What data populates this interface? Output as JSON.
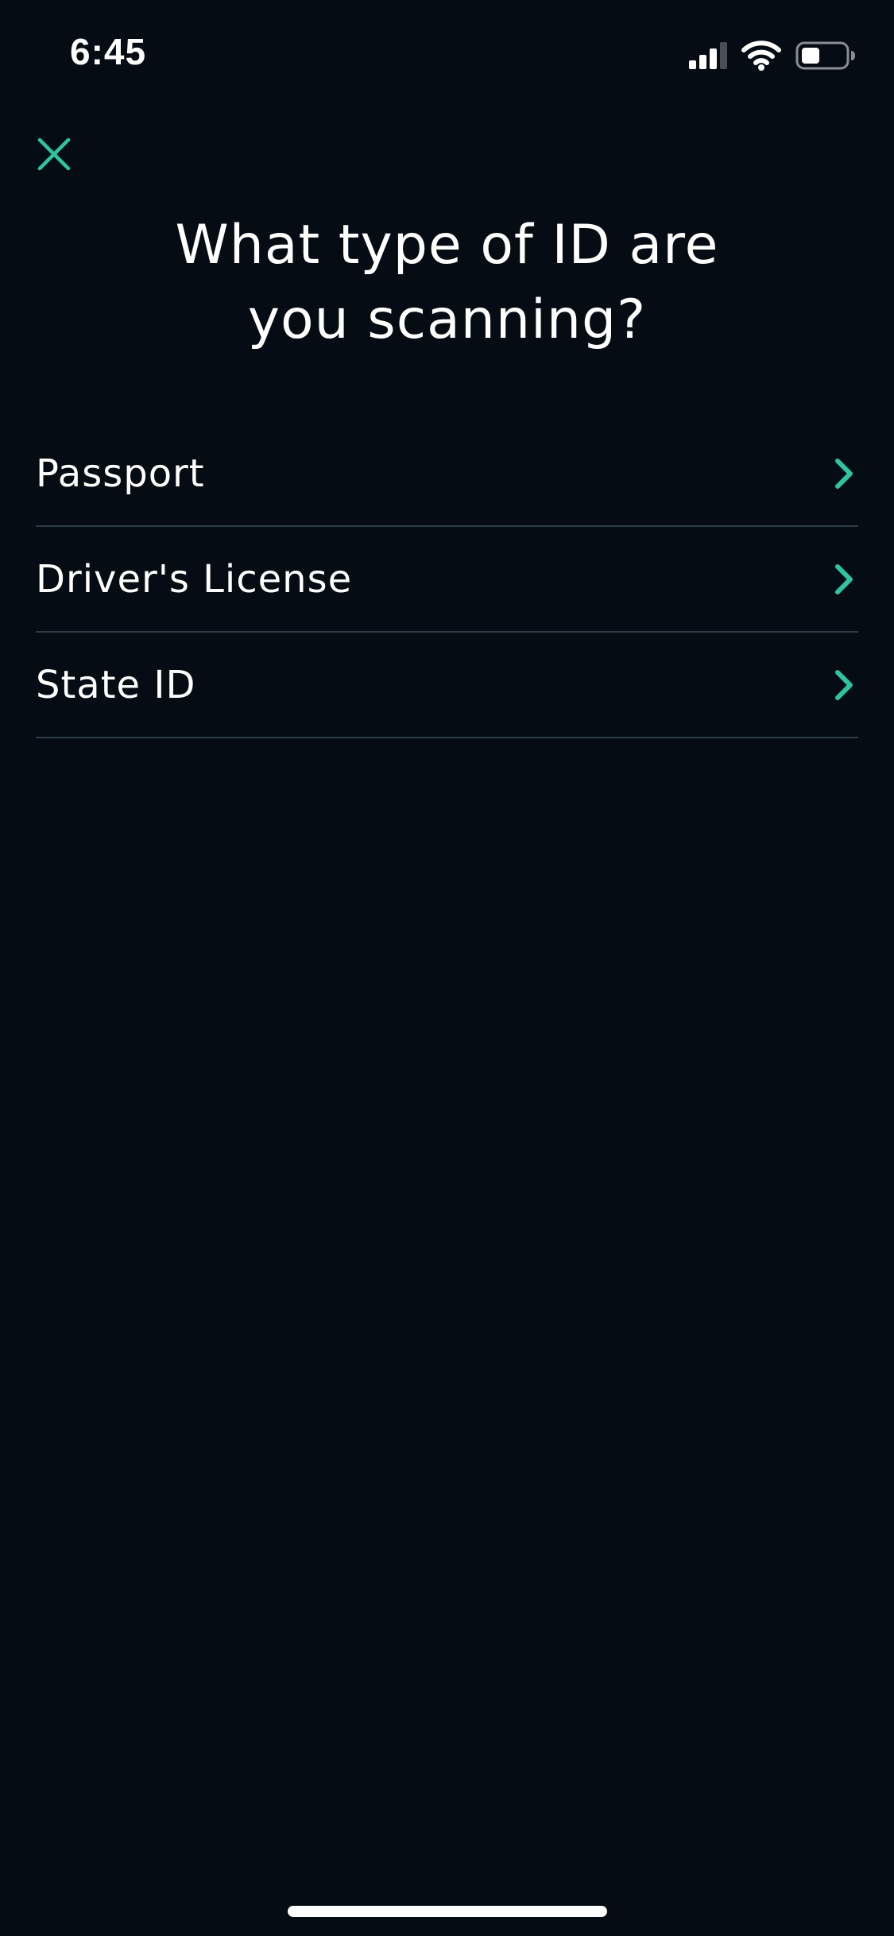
{
  "status_bar": {
    "time": "6:45",
    "signal_icon": "cellular-signal-icon",
    "wifi_icon": "wifi-icon",
    "battery_icon": "battery-icon"
  },
  "header": {
    "close_icon": "close-icon",
    "title_line_1": "What type of ID are",
    "title_line_2": "you scanning?"
  },
  "id_types": [
    {
      "label": "Passport"
    },
    {
      "label": "Driver's License"
    },
    {
      "label": "State ID"
    }
  ],
  "colors": {
    "background": "#060c14",
    "accent": "#2ec4a0",
    "divider": "#2c3b44",
    "text": "#ffffff"
  }
}
